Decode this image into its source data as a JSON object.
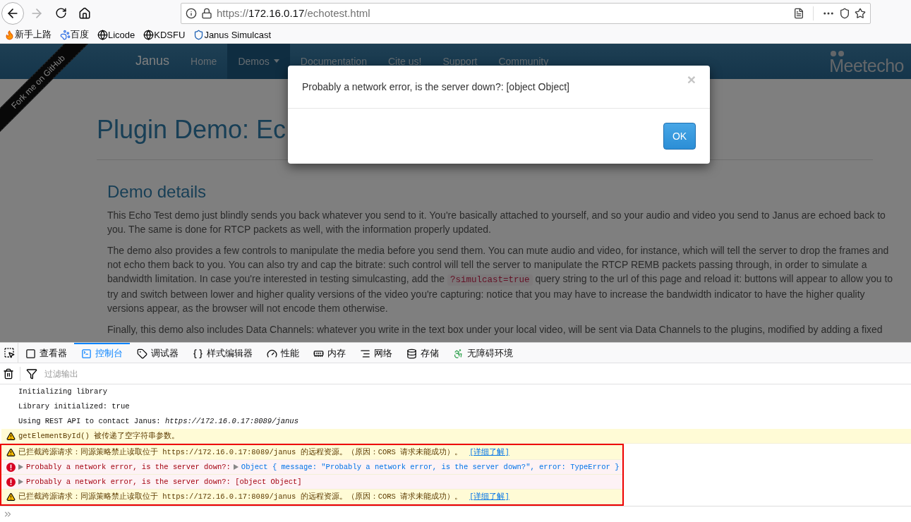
{
  "browser": {
    "url": {
      "scheme": "https://",
      "host": "172.16.0.17",
      "path": "/echotest.html"
    },
    "forward_disabled": true,
    "bookmarks": [
      {
        "label": "新手上路"
      },
      {
        "label": "百度"
      },
      {
        "label": "Licode"
      },
      {
        "label": "KDSFU"
      },
      {
        "label": "Janus Simulcast"
      }
    ]
  },
  "page": {
    "brand": "Janus",
    "nav": [
      {
        "label": "Home",
        "selected": false,
        "dropdown": false
      },
      {
        "label": "Demos",
        "selected": true,
        "dropdown": true
      },
      {
        "label": "Documentation",
        "selected": false,
        "dropdown": false
      },
      {
        "label": "Cite us!",
        "selected": false,
        "dropdown": false
      },
      {
        "label": "Support",
        "selected": false,
        "dropdown": false
      },
      {
        "label": "Community",
        "selected": false,
        "dropdown": false
      }
    ],
    "logo": "Meetecho",
    "ribbon": "Fork me on GitHub",
    "title": "Plugin Demo: Ec",
    "section_title": "Demo details",
    "paragraphs": [
      {
        "text": "This Echo Test demo just blindly sends you back whatever you send to it. You're basically attached to yourself, and so your audio and video you send to Janus are echoed back to you. The same is done for RTCP packets as well, with the information properly updated."
      },
      {
        "text": "The demo also provides a few controls to manipulate the media before you send them. You can mute audio and video, for instance, which will tell the server to drop the frames and not echo them back to you. You can also try and cap the bitrate: such control will tell the server to manipulate the RTCP REMB packets passing through, in order to simulate a bandwidth limitation. In case you're interested in testing simulcasting, add the ",
        "code": "?simulcast=true",
        "after": " query string to the url of this page and reload it: buttons will appear to allow you to try and switch between lower and higher quality versions of the video you're capturing: notice that you may have to increase the bandwidth indicator to have the higher quality versions appear, as the browser will not encode them otherwise."
      },
      {
        "text": "Finally, this demo also includes Data Channels: whatever you write in the text box under your local video, will be sent via Data Channels to the plugins, modified by adding a fixed"
      }
    ]
  },
  "dialog": {
    "message": "Probably a network error, is the server down?: [object Object]",
    "close": "×",
    "button": "OK"
  },
  "devtools": {
    "tabs": [
      {
        "label": "查看器",
        "selected": false
      },
      {
        "label": "控制台",
        "selected": true
      },
      {
        "label": "调试器",
        "selected": false
      },
      {
        "label": "样式编辑器",
        "selected": false
      },
      {
        "label": "性能",
        "selected": false
      },
      {
        "label": "内存",
        "selected": false
      },
      {
        "label": "网络",
        "selected": false
      },
      {
        "label": "存储",
        "selected": false
      },
      {
        "label": "无障碍环境",
        "selected": false
      }
    ],
    "filter": {
      "placeholder": "过滤输出"
    },
    "console": [
      {
        "kind": "log",
        "message": "Initializing library",
        "highlighted": false
      },
      {
        "kind": "log",
        "message": "Library initialized: true",
        "highlighted": false
      },
      {
        "kind": "log",
        "message": "Using REST API to contact Janus: *https://172.16.0.17:8089/janus*",
        "highlighted": false
      },
      {
        "kind": "warn",
        "message": "getElementById() 被传递了空字符串参数。",
        "highlighted": false
      },
      {
        "kind": "warn",
        "message": "已拦截跨源请求：同源策略禁止读取位于 https://172.16.0.17:8089/janus 的远程资源。（原因：CORS 请求未能成功）。",
        "link": "[详细了解]",
        "highlighted": true
      },
      {
        "kind": "error",
        "expandable": true,
        "message": "Probably a network error, is the server down?:",
        "object": "Object { message: \"Probably a network error, is the server down?\", error: TypeError }",
        "highlighted": true
      },
      {
        "kind": "error",
        "expandable": true,
        "message": "Probably a network error, is the server down?: [object Object]",
        "highlighted": true
      },
      {
        "kind": "warn",
        "message": "已拦截跨源请求：同源策略禁止读取位于 https://172.16.0.17:8089/janus 的远程资源。（原因：CORS 请求未能成功）。",
        "link": "[详细了解]",
        "highlighted": true
      }
    ]
  }
}
